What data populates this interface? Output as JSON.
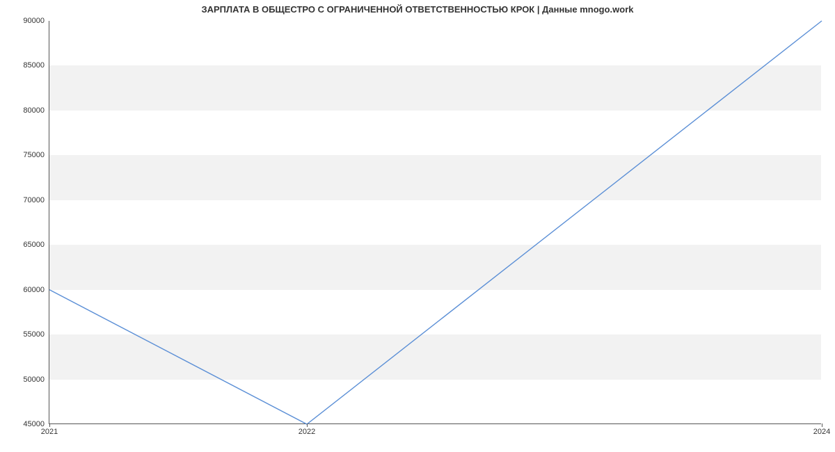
{
  "chart_data": {
    "type": "line",
    "title": "ЗАРПЛАТА В ОБЩЕСТРО С ОГРАНИЧЕННОЙ ОТВЕТСТВЕННОСТЬЮ КРОК | Данные mnogo.work",
    "xlabel": "",
    "ylabel": "",
    "x": [
      2021,
      2022,
      2024
    ],
    "values": [
      60000,
      45000,
      90000
    ],
    "x_ticks": [
      2021,
      2022,
      2024
    ],
    "y_ticks": [
      45000,
      50000,
      55000,
      60000,
      65000,
      70000,
      75000,
      80000,
      85000,
      90000
    ],
    "xlim": [
      2021,
      2024
    ],
    "ylim": [
      45000,
      90000
    ],
    "grid_bands": true,
    "line_color": "#5b8fd6"
  }
}
